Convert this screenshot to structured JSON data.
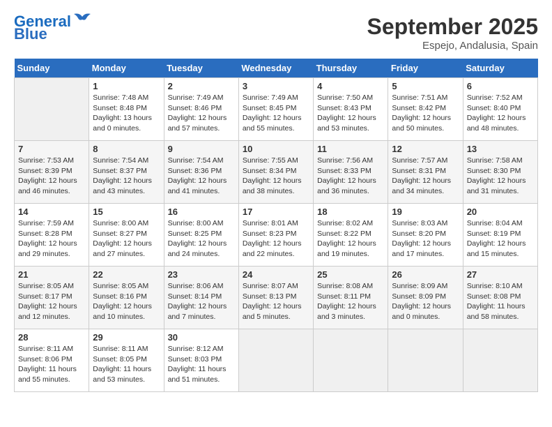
{
  "header": {
    "logo_line1": "General",
    "logo_line2": "Blue",
    "month": "September 2025",
    "location": "Espejo, Andalusia, Spain"
  },
  "weekdays": [
    "Sunday",
    "Monday",
    "Tuesday",
    "Wednesday",
    "Thursday",
    "Friday",
    "Saturday"
  ],
  "weeks": [
    [
      {
        "day": "",
        "empty": true
      },
      {
        "day": "1",
        "sunrise": "Sunrise: 7:48 AM",
        "sunset": "Sunset: 8:48 PM",
        "daylight": "Daylight: 13 hours and 0 minutes."
      },
      {
        "day": "2",
        "sunrise": "Sunrise: 7:49 AM",
        "sunset": "Sunset: 8:46 PM",
        "daylight": "Daylight: 12 hours and 57 minutes."
      },
      {
        "day": "3",
        "sunrise": "Sunrise: 7:49 AM",
        "sunset": "Sunset: 8:45 PM",
        "daylight": "Daylight: 12 hours and 55 minutes."
      },
      {
        "day": "4",
        "sunrise": "Sunrise: 7:50 AM",
        "sunset": "Sunset: 8:43 PM",
        "daylight": "Daylight: 12 hours and 53 minutes."
      },
      {
        "day": "5",
        "sunrise": "Sunrise: 7:51 AM",
        "sunset": "Sunset: 8:42 PM",
        "daylight": "Daylight: 12 hours and 50 minutes."
      },
      {
        "day": "6",
        "sunrise": "Sunrise: 7:52 AM",
        "sunset": "Sunset: 8:40 PM",
        "daylight": "Daylight: 12 hours and 48 minutes."
      }
    ],
    [
      {
        "day": "7",
        "sunrise": "Sunrise: 7:53 AM",
        "sunset": "Sunset: 8:39 PM",
        "daylight": "Daylight: 12 hours and 46 minutes."
      },
      {
        "day": "8",
        "sunrise": "Sunrise: 7:54 AM",
        "sunset": "Sunset: 8:37 PM",
        "daylight": "Daylight: 12 hours and 43 minutes."
      },
      {
        "day": "9",
        "sunrise": "Sunrise: 7:54 AM",
        "sunset": "Sunset: 8:36 PM",
        "daylight": "Daylight: 12 hours and 41 minutes."
      },
      {
        "day": "10",
        "sunrise": "Sunrise: 7:55 AM",
        "sunset": "Sunset: 8:34 PM",
        "daylight": "Daylight: 12 hours and 38 minutes."
      },
      {
        "day": "11",
        "sunrise": "Sunrise: 7:56 AM",
        "sunset": "Sunset: 8:33 PM",
        "daylight": "Daylight: 12 hours and 36 minutes."
      },
      {
        "day": "12",
        "sunrise": "Sunrise: 7:57 AM",
        "sunset": "Sunset: 8:31 PM",
        "daylight": "Daylight: 12 hours and 34 minutes."
      },
      {
        "day": "13",
        "sunrise": "Sunrise: 7:58 AM",
        "sunset": "Sunset: 8:30 PM",
        "daylight": "Daylight: 12 hours and 31 minutes."
      }
    ],
    [
      {
        "day": "14",
        "sunrise": "Sunrise: 7:59 AM",
        "sunset": "Sunset: 8:28 PM",
        "daylight": "Daylight: 12 hours and 29 minutes."
      },
      {
        "day": "15",
        "sunrise": "Sunrise: 8:00 AM",
        "sunset": "Sunset: 8:27 PM",
        "daylight": "Daylight: 12 hours and 27 minutes."
      },
      {
        "day": "16",
        "sunrise": "Sunrise: 8:00 AM",
        "sunset": "Sunset: 8:25 PM",
        "daylight": "Daylight: 12 hours and 24 minutes."
      },
      {
        "day": "17",
        "sunrise": "Sunrise: 8:01 AM",
        "sunset": "Sunset: 8:23 PM",
        "daylight": "Daylight: 12 hours and 22 minutes."
      },
      {
        "day": "18",
        "sunrise": "Sunrise: 8:02 AM",
        "sunset": "Sunset: 8:22 PM",
        "daylight": "Daylight: 12 hours and 19 minutes."
      },
      {
        "day": "19",
        "sunrise": "Sunrise: 8:03 AM",
        "sunset": "Sunset: 8:20 PM",
        "daylight": "Daylight: 12 hours and 17 minutes."
      },
      {
        "day": "20",
        "sunrise": "Sunrise: 8:04 AM",
        "sunset": "Sunset: 8:19 PM",
        "daylight": "Daylight: 12 hours and 15 minutes."
      }
    ],
    [
      {
        "day": "21",
        "sunrise": "Sunrise: 8:05 AM",
        "sunset": "Sunset: 8:17 PM",
        "daylight": "Daylight: 12 hours and 12 minutes."
      },
      {
        "day": "22",
        "sunrise": "Sunrise: 8:05 AM",
        "sunset": "Sunset: 8:16 PM",
        "daylight": "Daylight: 12 hours and 10 minutes."
      },
      {
        "day": "23",
        "sunrise": "Sunrise: 8:06 AM",
        "sunset": "Sunset: 8:14 PM",
        "daylight": "Daylight: 12 hours and 7 minutes."
      },
      {
        "day": "24",
        "sunrise": "Sunrise: 8:07 AM",
        "sunset": "Sunset: 8:13 PM",
        "daylight": "Daylight: 12 hours and 5 minutes."
      },
      {
        "day": "25",
        "sunrise": "Sunrise: 8:08 AM",
        "sunset": "Sunset: 8:11 PM",
        "daylight": "Daylight: 12 hours and 3 minutes."
      },
      {
        "day": "26",
        "sunrise": "Sunrise: 8:09 AM",
        "sunset": "Sunset: 8:09 PM",
        "daylight": "Daylight: 12 hours and 0 minutes."
      },
      {
        "day": "27",
        "sunrise": "Sunrise: 8:10 AM",
        "sunset": "Sunset: 8:08 PM",
        "daylight": "Daylight: 11 hours and 58 minutes."
      }
    ],
    [
      {
        "day": "28",
        "sunrise": "Sunrise: 8:11 AM",
        "sunset": "Sunset: 8:06 PM",
        "daylight": "Daylight: 11 hours and 55 minutes."
      },
      {
        "day": "29",
        "sunrise": "Sunrise: 8:11 AM",
        "sunset": "Sunset: 8:05 PM",
        "daylight": "Daylight: 11 hours and 53 minutes."
      },
      {
        "day": "30",
        "sunrise": "Sunrise: 8:12 AM",
        "sunset": "Sunset: 8:03 PM",
        "daylight": "Daylight: 11 hours and 51 minutes."
      },
      {
        "day": "",
        "empty": true
      },
      {
        "day": "",
        "empty": true
      },
      {
        "day": "",
        "empty": true
      },
      {
        "day": "",
        "empty": true
      }
    ]
  ]
}
